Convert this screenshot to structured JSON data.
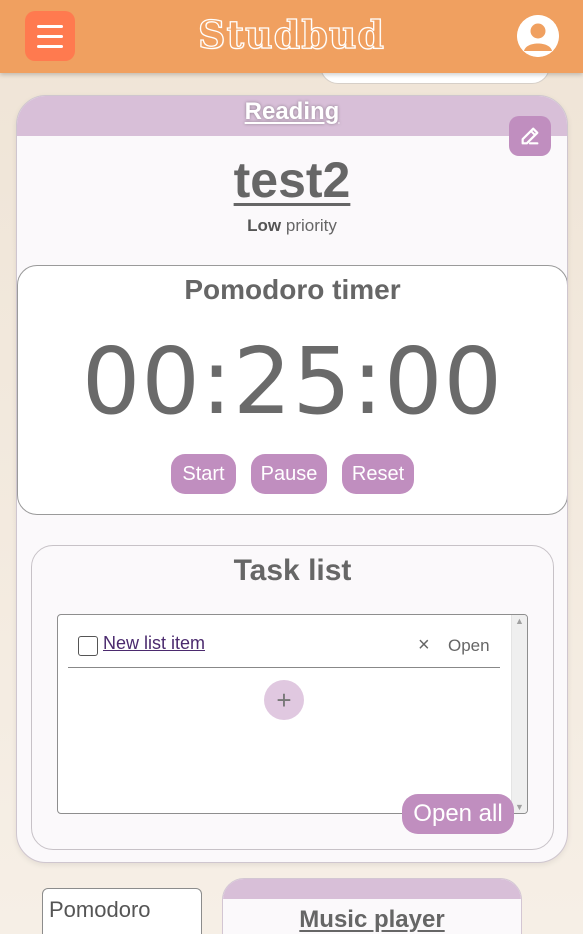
{
  "app": {
    "brand": "Studbud",
    "colors": {
      "topbar": "#f0a060",
      "menu_button": "#ff7a4f",
      "accent": "#c08ebf",
      "card_header": "#d8bfd8"
    },
    "icons": {
      "menu": "hamburger-icon",
      "user": "user-avatar-icon",
      "edit": "edit-pencil-icon",
      "remove": "close-icon",
      "add": "plus-icon"
    }
  },
  "task_card": {
    "category": "Reading",
    "name": "test2",
    "priority_level": "Low",
    "priority_suffix": "priority"
  },
  "pomodoro": {
    "title": "Pomodoro timer",
    "time": "00:25:00",
    "buttons": {
      "start": "Start",
      "pause": "Pause",
      "reset": "Reset"
    }
  },
  "tasklist": {
    "title": "Task list",
    "items": [
      {
        "label": "New list item",
        "checked": false,
        "remove": "×",
        "open": "Open"
      }
    ],
    "add_label": "+",
    "open_all": "Open all"
  },
  "bottom": {
    "pomodoro_mini": "Pomodoro",
    "music_player": "Music player"
  }
}
